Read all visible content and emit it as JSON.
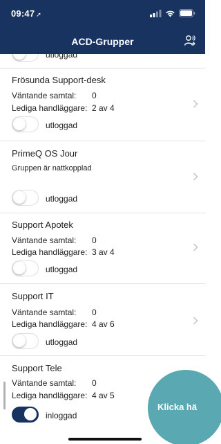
{
  "status_bar": {
    "time": "09:47"
  },
  "header": {
    "title": "ACD-Grupper",
    "action_icon": "person-wave-icon"
  },
  "labels": {
    "waiting": "Väntande samtal:",
    "available": "Lediga handläggare:"
  },
  "top_partial": {
    "toggle_label": "utloggad"
  },
  "groups": [
    {
      "name": "Frösunda Support-desk",
      "waiting": "0",
      "available": "2 av 4",
      "toggle_label": "utloggad",
      "logged_in": false
    },
    {
      "name": "PrimeQ OS Jour",
      "note": "Gruppen är nattkopplad",
      "toggle_label": "utloggad",
      "logged_in": false
    },
    {
      "name": "Support Apotek",
      "waiting": "0",
      "available": "3 av 4",
      "toggle_label": "utloggad",
      "logged_in": false
    },
    {
      "name": "Support IT",
      "waiting": "0",
      "available": "4 av 6",
      "toggle_label": "utloggad",
      "logged_in": false
    },
    {
      "name": "Support Tele",
      "waiting": "0",
      "available": "4 av 5",
      "toggle_label": "inloggad",
      "logged_in": true
    }
  ],
  "fab": {
    "label": "Klicka hä",
    "color": "#5aa9b2"
  },
  "colors": {
    "header_bg": "#18335f",
    "toggle_on": "#18335f",
    "divider": "#e3e3e3"
  }
}
